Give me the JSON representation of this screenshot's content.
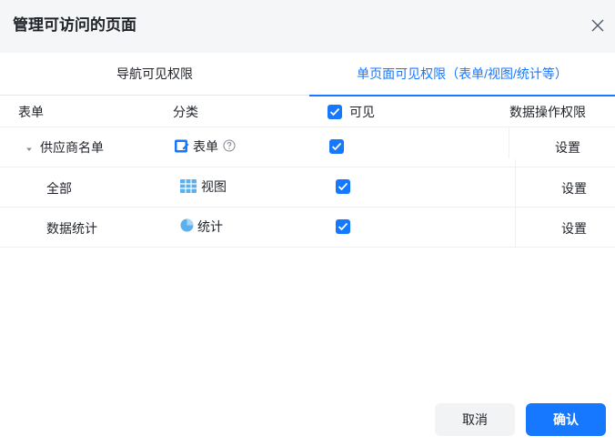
{
  "dialog": {
    "title": "管理可访问的页面",
    "close_icon": "close-icon"
  },
  "tabs": [
    {
      "label": "导航可见权限",
      "active": false
    },
    {
      "label": "单页面可见权限（表单/视图/统计等）",
      "active": true
    }
  ],
  "columns": {
    "form": "表单",
    "category": "分类",
    "visible": "可见",
    "data_permission": "数据操作权限"
  },
  "rows": [
    {
      "name": "供应商名单",
      "category": "表单",
      "category_icon": "form-edit-icon",
      "visible": true,
      "action": "设置",
      "expandable": true,
      "help_icon": "question-circle-icon"
    },
    {
      "name": "全部",
      "category": "视图",
      "category_icon": "table-view-icon",
      "visible": true,
      "action": "设置"
    },
    {
      "name": "数据统计",
      "category": "统计",
      "category_icon": "pie-chart-icon",
      "visible": true,
      "action": "设置"
    }
  ],
  "footer": {
    "cancel": "取消",
    "confirm": "确认"
  },
  "colors": {
    "accent": "#1677ff",
    "header_bg": "#f5f6f7",
    "icon_light_blue": "#5ab1ef"
  }
}
